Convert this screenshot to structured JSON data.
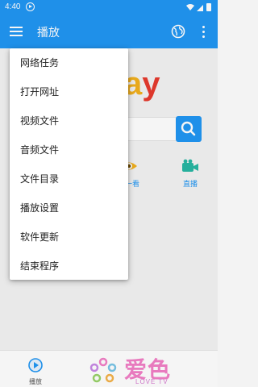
{
  "status_bar": {
    "time": "4:40",
    "icons": [
      "play-circle-icon",
      "wifi-icon",
      "signal-icon",
      "battery-icon"
    ]
  },
  "app_bar": {
    "title": "播放",
    "icons": [
      "menu-icon",
      "globe-icon",
      "more-vert-icon"
    ]
  },
  "colors": {
    "primary": "#2196f3",
    "brand_yellow": "#f2b01e",
    "brand_red": "#e63b2e",
    "logo_pink": "#f27fc6"
  },
  "background": {
    "brand_partial": {
      "a": "a",
      "y": "y"
    },
    "shortcuts": [
      {
        "label": "看一看",
        "visible_label": "看一看",
        "icon": "eye-icon"
      },
      {
        "label": "直播",
        "icon": "live-camera-icon"
      }
    ]
  },
  "popup_menu": {
    "items": [
      {
        "label": "网络任务"
      },
      {
        "label": "打开网址"
      },
      {
        "label": "视频文件"
      },
      {
        "label": "音频文件"
      },
      {
        "label": "文件目录"
      },
      {
        "label": "播放设置"
      },
      {
        "label": "软件更新"
      },
      {
        "label": "结束程序"
      }
    ]
  },
  "bottom_bar": {
    "tab_play_label": "播放",
    "logo_cn": "爱色",
    "logo_en": "LOVE TV"
  }
}
